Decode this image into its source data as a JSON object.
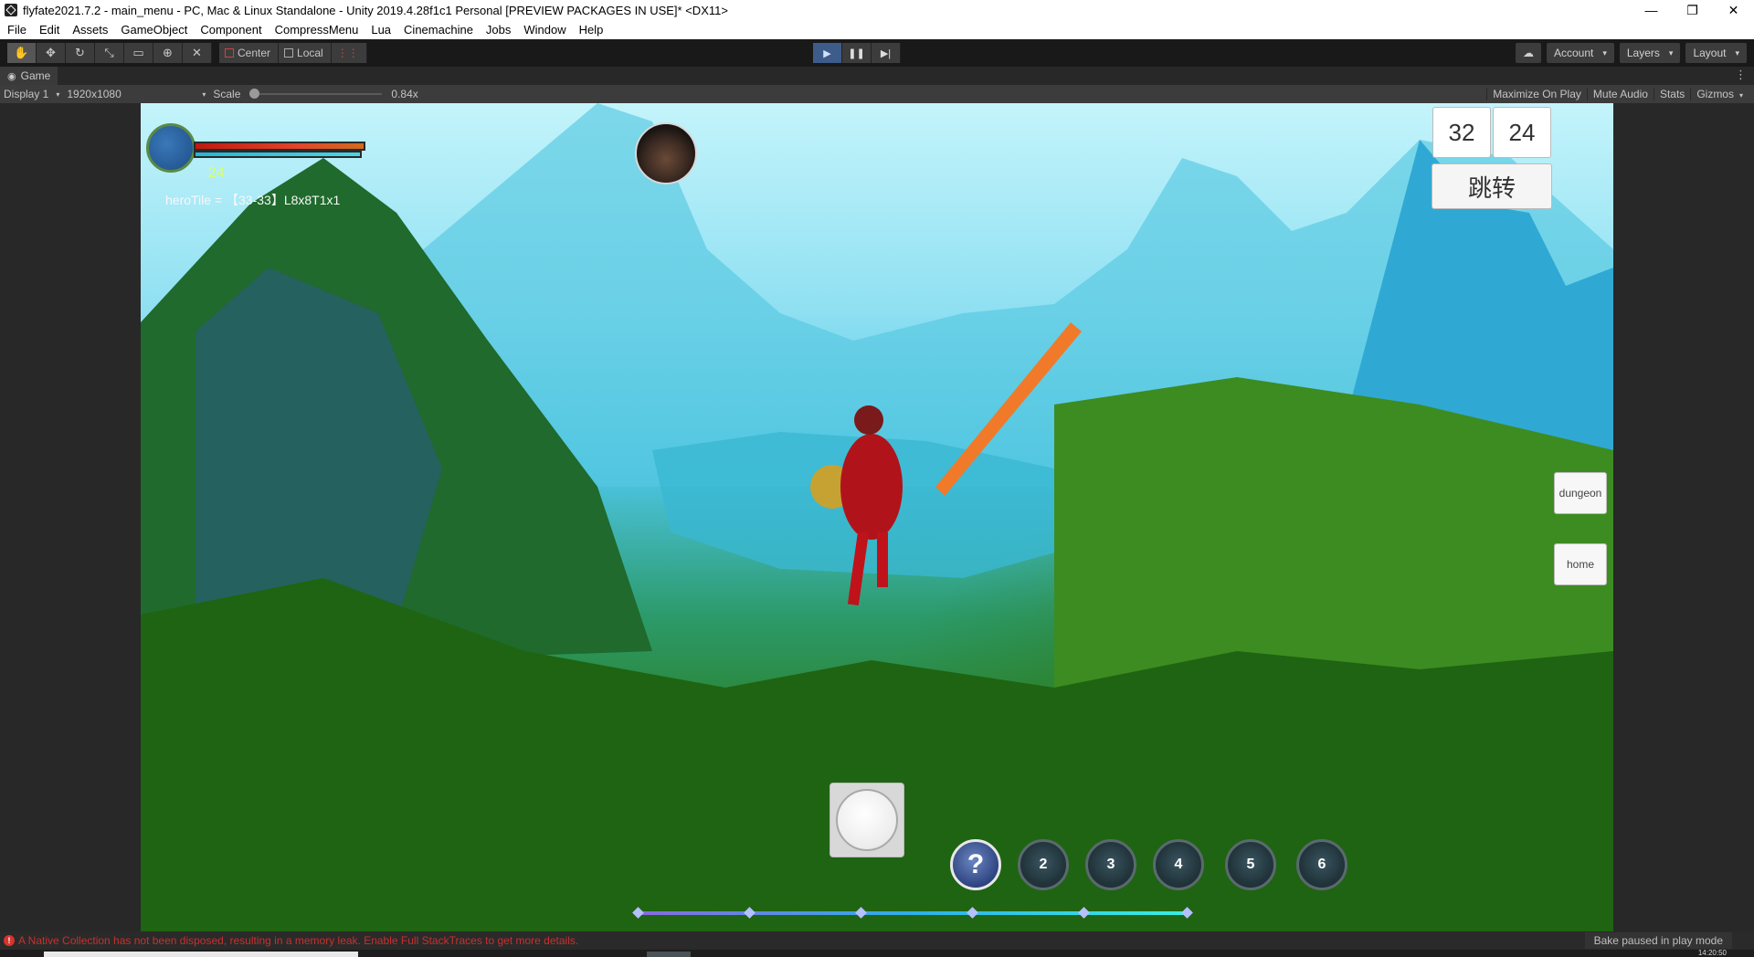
{
  "window": {
    "title": "flyfate2021.7.2 - main_menu - PC, Mac & Linux Standalone - Unity 2019.4.28f1c1 Personal [PREVIEW PACKAGES IN USE]* <DX11>",
    "minimize_glyph": "—",
    "restore_glyph": "❐",
    "close_glyph": "✕"
  },
  "menubar": {
    "items": [
      "File",
      "Edit",
      "Assets",
      "GameObject",
      "Component",
      "CompressMenu",
      "Lua",
      "Cinemachine",
      "Jobs",
      "Window",
      "Help"
    ]
  },
  "toolbar": {
    "tools": [
      {
        "name": "hand-tool-icon",
        "glyph": "✋"
      },
      {
        "name": "move-tool-icon",
        "glyph": "✥"
      },
      {
        "name": "rotate-tool-icon",
        "glyph": "↻"
      },
      {
        "name": "scale-tool-icon",
        "glyph": "⤡"
      },
      {
        "name": "rect-tool-icon",
        "glyph": "▭"
      },
      {
        "name": "transform-tool-icon",
        "glyph": "⊕"
      },
      {
        "name": "custom-tool-icon",
        "glyph": "✕"
      }
    ],
    "pivot_label": "Center",
    "space_label": "Local",
    "snap_glyph": "⋮⋮",
    "play_glyph": "▶",
    "pause_glyph": "❚❚",
    "step_glyph": "▶|",
    "cloud_glyph": "☁",
    "account_label": "Account",
    "layers_label": "Layers",
    "layout_label": "Layout",
    "caret": "▾"
  },
  "tab": {
    "label": "Game",
    "gamepad_glyph": "◉",
    "menu_glyph": "⋮"
  },
  "gamebar": {
    "display": "Display 1",
    "resolution": "1920x1080",
    "scale_label": "Scale",
    "scale_value": "0.84x",
    "scale_fraction": 0.0,
    "maximize_label": "Maximize On Play",
    "mute_label": "Mute Audio",
    "stats_label": "Stats",
    "gizmos_label": "Gizmos",
    "caret": "▾"
  },
  "game": {
    "level": "24",
    "hero_tile": "heroTile = 【33-33】L8x8T1x1",
    "coord_x": "32",
    "coord_y": "24",
    "jump_label": "跳转",
    "dungeon_label": "dungeon",
    "home_label": "home",
    "skills": [
      {
        "label": "?",
        "help": true
      },
      {
        "label": "2"
      },
      {
        "label": "3"
      },
      {
        "label": "4"
      },
      {
        "label": "5"
      },
      {
        "label": "6"
      }
    ],
    "exp_fraction": 1.0
  },
  "status": {
    "error_glyph": "!",
    "error_text": "A Native Collection has not been disposed, resulting in a memory leak. Enable Full StackTraces to get more details.",
    "bake_text": "Bake paused in play mode"
  },
  "taskbar": {
    "clock": "14:20:50"
  }
}
